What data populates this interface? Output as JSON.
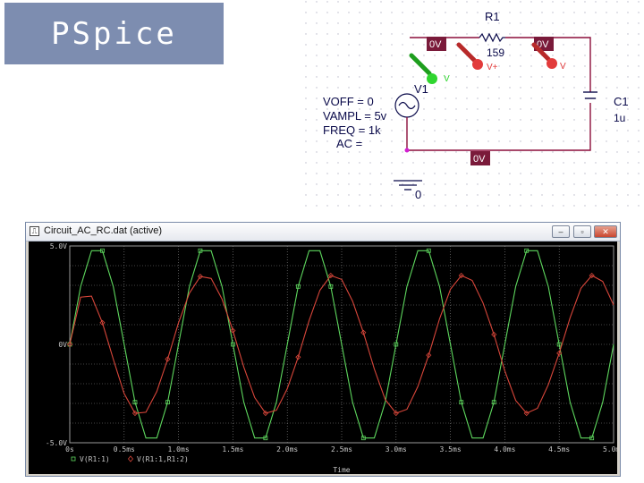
{
  "slide": {
    "title": "PSpice"
  },
  "schematic": {
    "resistor": {
      "name": "R1",
      "value": "159"
    },
    "capacitor": {
      "name": "C1",
      "value": "1u"
    },
    "source": {
      "name": "V1",
      "params": [
        "VOFF = 0",
        "VAMPL = 5v",
        "FREQ = 1k",
        "AC ="
      ]
    },
    "voltage_labels": {
      "node1": "0V",
      "node2": "0V",
      "ground_bus": "0V"
    },
    "ground_label": "0",
    "probe_labels": {
      "probe1": "V",
      "probe2": "V+",
      "probe3": "V"
    },
    "colors": {
      "label_bg": "#7a1a3a",
      "wire": "#8b0d3a",
      "probe_green": "#2fd62f",
      "probe_red": "#e23b3b"
    }
  },
  "window": {
    "title": "Circuit_AC_RC.dat (active)",
    "buttons": {
      "minimize": "–",
      "restore": "▫",
      "close": "✕"
    }
  },
  "chart_data": {
    "type": "line",
    "x_label": "Time",
    "x_ticks": [
      "0s",
      "0.5ms",
      "1.0ms",
      "1.5ms",
      "2.0ms",
      "2.5ms",
      "3.0ms",
      "3.5ms",
      "4.0ms",
      "4.5ms",
      "5.0ms"
    ],
    "y_ticks": [
      "5.0V",
      "0V",
      "-5.0V"
    ],
    "xlim": [
      0,
      5
    ],
    "ylim": [
      -5,
      5
    ],
    "x_unit": "ms",
    "grid": true,
    "series": [
      {
        "name": "V(R1:1)",
        "color": "#5ed85e",
        "marker": "square",
        "x": [
          0,
          0.1,
          0.2,
          0.3,
          0.4,
          0.5,
          0.6,
          0.7,
          0.8,
          0.9,
          1.0,
          1.1,
          1.2,
          1.3,
          1.4,
          1.5,
          1.6,
          1.7,
          1.8,
          1.9,
          2.0,
          2.1,
          2.2,
          2.3,
          2.4,
          2.5,
          2.6,
          2.7,
          2.8,
          2.9,
          3.0,
          3.1,
          3.2,
          3.3,
          3.4,
          3.5,
          3.6,
          3.7,
          3.8,
          3.9,
          4.0,
          4.1,
          4.2,
          4.3,
          4.4,
          4.5,
          4.6,
          4.7,
          4.8,
          4.9,
          5.0
        ],
        "y": [
          0,
          2.94,
          4.76,
          4.76,
          2.94,
          0,
          -2.94,
          -4.76,
          -4.76,
          -2.94,
          0,
          2.94,
          4.76,
          4.76,
          2.94,
          0,
          -2.94,
          -4.76,
          -4.76,
          -2.94,
          0,
          2.94,
          4.76,
          4.76,
          2.94,
          0,
          -2.94,
          -4.76,
          -4.76,
          -2.94,
          0,
          2.94,
          4.76,
          4.76,
          2.94,
          0,
          -2.94,
          -4.76,
          -4.76,
          -2.94,
          0,
          2.94,
          4.76,
          4.76,
          2.94,
          0,
          -2.94,
          -4.76,
          -4.76,
          -2.94,
          0
        ]
      },
      {
        "name": "V(R1:1,R1:2)",
        "color": "#d8463a",
        "marker": "diamond",
        "x": [
          0,
          0.1,
          0.2,
          0.3,
          0.4,
          0.5,
          0.6,
          0.7,
          0.8,
          0.9,
          1.0,
          1.1,
          1.2,
          1.3,
          1.4,
          1.5,
          1.6,
          1.7,
          1.8,
          1.9,
          2.0,
          2.1,
          2.2,
          2.3,
          2.4,
          2.5,
          2.6,
          2.7,
          2.8,
          2.9,
          3.0,
          3.1,
          3.2,
          3.3,
          3.4,
          3.5,
          3.6,
          3.7,
          3.8,
          3.9,
          4.0,
          4.1,
          4.2,
          4.3,
          4.4,
          4.5,
          4.6,
          4.7,
          4.8,
          4.9,
          5.0
        ],
        "y": [
          0,
          2.4,
          2.45,
          1.1,
          -0.75,
          -2.5,
          -3.5,
          -3.45,
          -2.4,
          -0.75,
          1.1,
          2.6,
          3.45,
          3.35,
          2.3,
          0.7,
          -1.15,
          -2.7,
          -3.5,
          -3.35,
          -2.25,
          -0.65,
          1.2,
          2.75,
          3.5,
          3.3,
          2.2,
          0.6,
          -1.25,
          -2.8,
          -3.5,
          -3.3,
          -2.15,
          -0.55,
          1.3,
          2.8,
          3.5,
          3.25,
          2.1,
          0.5,
          -1.35,
          -2.85,
          -3.5,
          -3.25,
          -2.05,
          -0.45,
          1.35,
          2.85,
          3.5,
          3.2,
          2.0
        ]
      }
    ]
  }
}
